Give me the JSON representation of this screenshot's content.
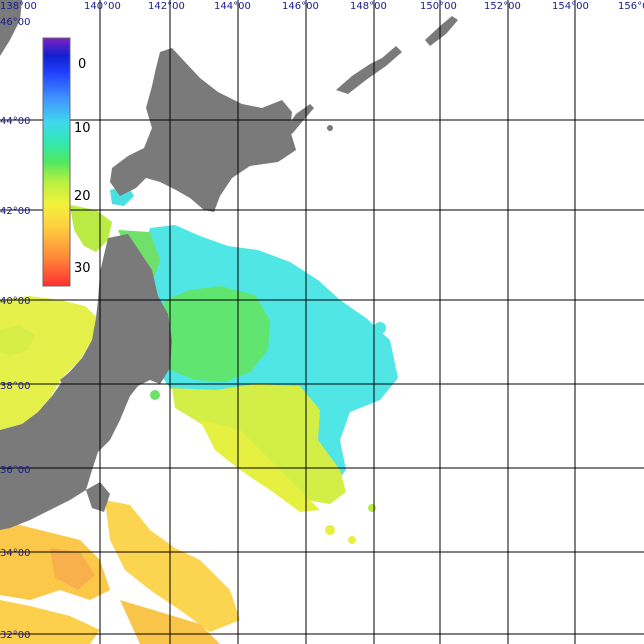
{
  "map": {
    "longitude_labels": [
      "138°00",
      "140°00",
      "142°00",
      "144°00",
      "146°00",
      "148°00",
      "150°00",
      "152°00",
      "154°00",
      "156°0"
    ],
    "latitude_labels": [
      "46°00",
      "44°00",
      "42°00",
      "40°00",
      "38°00",
      "36°00",
      "34°00",
      "32°00"
    ]
  },
  "colorbar": {
    "ticks": [
      "0",
      "10",
      "20",
      "30"
    ],
    "stops": [
      "#ff3030",
      "#ff8c3a",
      "#ffd040",
      "#f2f23a",
      "#b8f040",
      "#50e860",
      "#30e8b0",
      "#40d8f0",
      "#4090ff",
      "#2040ff",
      "#1020d0",
      "#8020c0"
    ]
  },
  "colors": {
    "land": "#7a7a7a",
    "grid": "#000000",
    "water": "#ffffff"
  }
}
